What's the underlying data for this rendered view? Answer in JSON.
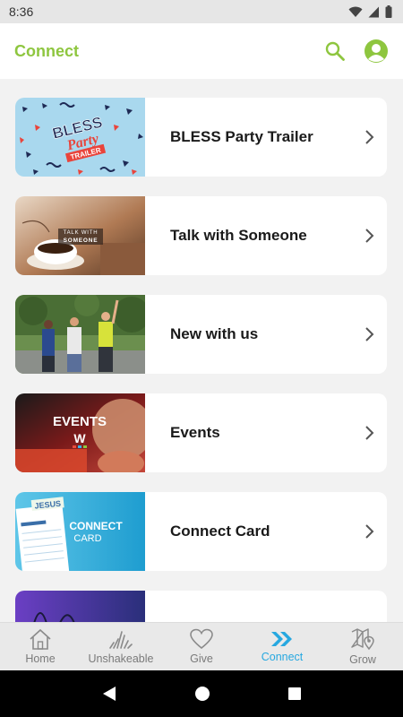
{
  "status_bar": {
    "time": "8:36"
  },
  "header": {
    "title": "Connect",
    "search_icon": "search-icon",
    "profile_icon": "profile-icon"
  },
  "colors": {
    "accent_green": "#8ec63f",
    "active_tab": "#27a8e0",
    "inactive_tab": "#7a7a7a"
  },
  "cards": [
    {
      "label": "BLESS Party Trailer",
      "thumb_text": [
        "BLESS",
        "Party",
        "TRAILER"
      ]
    },
    {
      "label": "Talk with Someone",
      "thumb_text": [
        "TALK WITH",
        "SOMEONE"
      ]
    },
    {
      "label": "New with us"
    },
    {
      "label": "Events",
      "thumb_text": [
        "EVENTS",
        "W"
      ]
    },
    {
      "label": "Connect Card",
      "thumb_text": [
        "JESUS",
        "CONNECT",
        "CARD"
      ]
    },
    {
      "label": ""
    }
  ],
  "tabs": [
    {
      "label": "Home",
      "icon": "home-icon"
    },
    {
      "label": "Unshakeable",
      "icon": "wave-icon"
    },
    {
      "label": "Give",
      "icon": "heart-icon"
    },
    {
      "label": "Connect",
      "icon": "double-chevron-icon",
      "active": true
    },
    {
      "label": "Grow",
      "icon": "map-icon"
    }
  ]
}
